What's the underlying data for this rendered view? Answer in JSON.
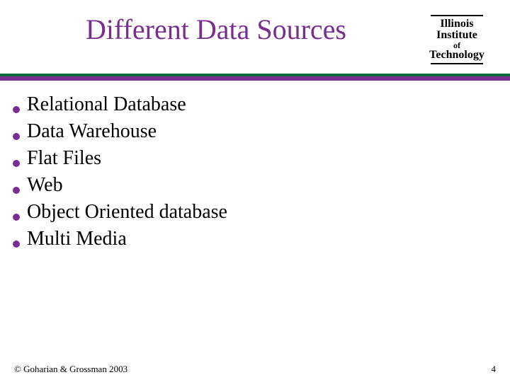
{
  "header": {
    "title": "Different Data Sources",
    "logo": {
      "l1": "Illinois",
      "l2": "Institute",
      "l3": "of",
      "l4": "Technology"
    }
  },
  "bullets": [
    "Relational Database",
    "Data Warehouse",
    "Flat Files",
    "Web",
    "Object Oriented database",
    "Multi Media"
  ],
  "footer": {
    "copyright": "© Goharian & Grossman 2003",
    "page": "4"
  }
}
